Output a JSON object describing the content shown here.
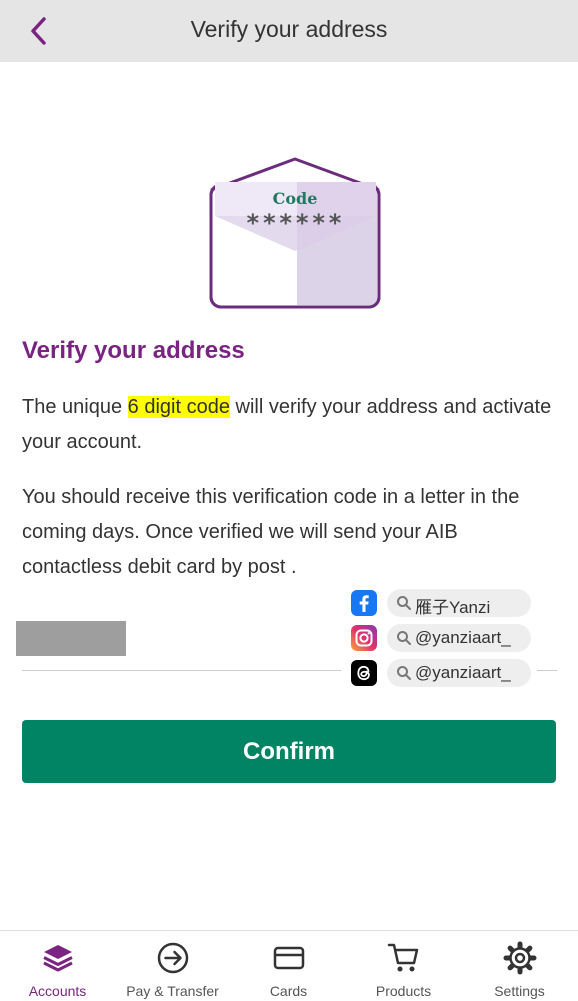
{
  "header": {
    "title": "Verify your address",
    "back_icon": "chevron-left-icon"
  },
  "illustration": {
    "icon": "envelope-code-icon",
    "code_label": "Code",
    "code_mask": "******"
  },
  "content": {
    "heading": "Verify your address",
    "para1_before": "The unique ",
    "para1_highlight": "6 digit code",
    "para1_after": " will verify your address and activate your account.",
    "para2": "You should receive this verification code in a letter in the coming days. Once verified we will send your AIB contactless debit card by post ."
  },
  "code_input": {
    "value": "",
    "placeholder": ""
  },
  "watermark": {
    "facebook": "雁子Yanzi",
    "instagram": "@yanziaart_",
    "threads": "@yanziaart_"
  },
  "confirm_label": "Confirm",
  "tabbar": {
    "tabs": [
      {
        "label": "Accounts",
        "icon": "layers-icon",
        "active": true
      },
      {
        "label": "Pay & Transfer",
        "icon": "arrow-circle-right-icon",
        "active": false
      },
      {
        "label": "Cards",
        "icon": "card-icon",
        "active": false
      },
      {
        "label": "Products",
        "icon": "cart-icon",
        "active": false
      },
      {
        "label": "Settings",
        "icon": "gear-icon",
        "active": false
      }
    ]
  },
  "colors": {
    "brand_purple": "#7b2382",
    "confirm_green": "#008463",
    "highlight_yellow": "#ffff00",
    "header_gray": "#e5e5e5"
  }
}
